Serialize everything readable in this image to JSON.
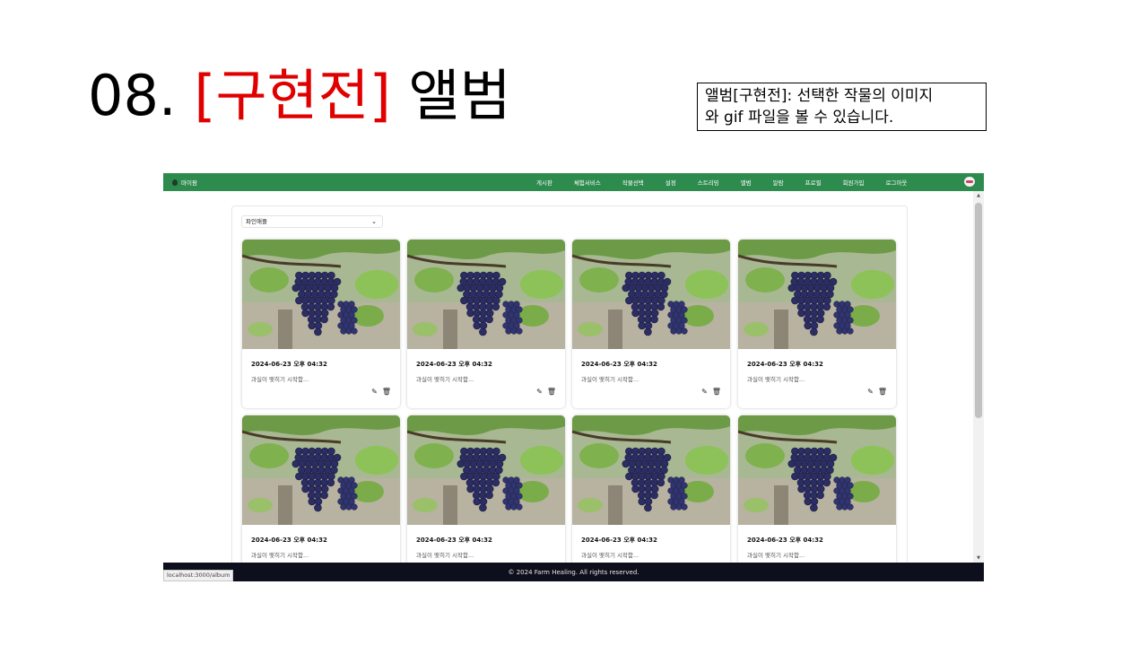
{
  "slide": {
    "title_prefix": "08.",
    "title_highlight": "[구현전]",
    "title_suffix": "앨범",
    "note_line1": "앨범[구현전]: 선택한 작물의 이미지",
    "note_line2": "와 gif 파일을 볼 수 있습니다.",
    "colors": {
      "highlight": "#e00000"
    }
  },
  "app": {
    "brand": "마이팜",
    "nav": [
      "게시판",
      "체험서비스",
      "작물선택",
      "설정",
      "스트리밍",
      "앨범",
      "알람",
      "프로필",
      "회원가입",
      "로그아웃"
    ],
    "crop_select": {
      "value": "파인애플"
    },
    "cards": [
      {
        "date": "2024-06-23 오후 04:32",
        "text": "과실이 맺히기 시작함..."
      },
      {
        "date": "2024-06-23 오후 04:32",
        "text": "과실이 맺히기 시작함..."
      },
      {
        "date": "2024-06-23 오후 04:32",
        "text": "과실이 맺히기 시작함..."
      },
      {
        "date": "2024-06-23 오후 04:32",
        "text": "과실이 맺히기 시작함..."
      },
      {
        "date": "2024-06-23 오후 04:32",
        "text": "과실이 맺히기 시작함..."
      },
      {
        "date": "2024-06-23 오후 04:32",
        "text": "과실이 맺히기 시작함..."
      },
      {
        "date": "2024-06-23 오후 04:32",
        "text": "과실이 맺히기 시작함..."
      },
      {
        "date": "2024-06-23 오후 04:32",
        "text": "과실이 맺히기 시작함..."
      }
    ],
    "footer": "© 2024 Farm Healing. All rights reserved.",
    "status_url": "localhost:3000/album",
    "colors": {
      "navbar": "#2e8b4e",
      "footer": "#0d0f1c"
    },
    "icons": {
      "edit": "edit-icon",
      "delete": "trash-icon",
      "avatar": "avatar-icon"
    }
  }
}
